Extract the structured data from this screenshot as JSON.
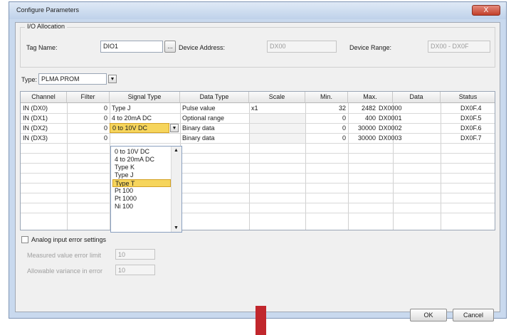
{
  "window": {
    "title": "Configure Parameters",
    "close_label": "X"
  },
  "group": {
    "legend": "I/O Allocation"
  },
  "tag": {
    "label": "Tag Name:",
    "value": "DIO1",
    "browse_label": "..."
  },
  "device_address": {
    "label": "Device Address:",
    "value": "DX00"
  },
  "device_range": {
    "label": "Device Range:",
    "value": "DX00 - DX0F"
  },
  "type": {
    "label": "Type:",
    "value": "PLMA PROM"
  },
  "table": {
    "headers": [
      "Channel",
      "Filter",
      "Signal Type",
      "Data Type",
      "Scale",
      "Min.",
      "Max.",
      "Data",
      "Status"
    ],
    "rows": [
      {
        "channel": "IN (DX0)",
        "filter": "0",
        "signal": "Type J",
        "dtype": "Pulse value",
        "scale": "x1",
        "min": "32",
        "max": "2482",
        "data": "DX0000",
        "status": "DX0F.4"
      },
      {
        "channel": "IN (DX1)",
        "filter": "0",
        "signal": "4 to 20mA DC",
        "dtype": "Optional range",
        "scale": "",
        "min": "0",
        "max": "400",
        "data": "DX0001",
        "status": "DX0F.5"
      },
      {
        "channel": "IN (DX2)",
        "filter": "0",
        "signal": "0 to 10V DC",
        "dtype": "Binary data",
        "scale": "",
        "min": "0",
        "max": "30000",
        "data": "DX0002",
        "status": "DX0F.6"
      },
      {
        "channel": "IN (DX3)",
        "filter": "0",
        "signal": "",
        "dtype": "Binary data",
        "scale": "",
        "min": "0",
        "max": "30000",
        "data": "DX0003",
        "status": "DX0F.7"
      }
    ]
  },
  "signal_options": [
    "0 to 10V DC",
    "4 to 20mA DC",
    "Type K",
    "Type J",
    "Type T",
    "Pt 100",
    "Pt 1000",
    "Ni 100"
  ],
  "selected_signal": "Type T",
  "analog": {
    "label": "Analog input error settings",
    "field1_label": "Measured value error limit",
    "field1_value": "10",
    "field2_label": "Allowable variance in error",
    "field2_value": "10"
  },
  "buttons": {
    "ok": "OK",
    "cancel": "Cancel"
  },
  "colors": {
    "selection": "#f6d55c",
    "marker": "#c1272d",
    "window_frame": "#c9d9ee"
  }
}
